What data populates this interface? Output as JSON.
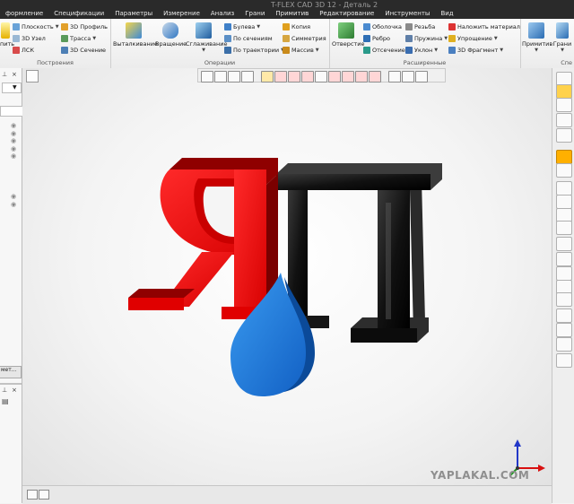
{
  "window_title": "T-FLEX CAD 3D 12 - Деталь 2",
  "menu_tabs": [
    "формление",
    "Спецификации",
    "Параметры",
    "Измерение",
    "Анализ",
    "Грани",
    "Примитив",
    "Редактирование",
    "Инструменты",
    "Вид"
  ],
  "ribbon": {
    "build": {
      "partial_left": "пить",
      "plane": "Плоскость",
      "node3d": "3D Узел",
      "lsk": "ЛСК",
      "profile3d": "3D Профиль",
      "path": "Трасса",
      "section3d": "3D Сечение",
      "label": "Построения"
    },
    "ops": {
      "extrude": "Выталкивание",
      "rotate": "Вращение",
      "smooth": "Сглаживание",
      "boolean": "Булева",
      "by_sections": "По сечениям",
      "by_path": "По траектории",
      "copy": "Копия",
      "symmetry": "Симметрия",
      "array": "Массив",
      "label": "Операции"
    },
    "ext": {
      "hole": "Отверстие",
      "shell": "Оболочка",
      "edge": "Ребро",
      "cut": "Отсечение",
      "thread": "Резьба",
      "spring": "Пружина",
      "slope": "Уклон",
      "material": "Наложить материал",
      "simplify": "Упрощение",
      "fragment3d": "3D Фрагмент",
      "label": "Расширенные"
    },
    "right": {
      "primitives": "Примитив",
      "faces": "Грани",
      "partial_label": "Спе"
    }
  },
  "left_panel": {
    "tab_partial": "мет..."
  },
  "watermark": "YAPLAKAL.COM",
  "model_letters": [
    "Я",
    "П"
  ],
  "colors": {
    "letter1": "#e00b0b",
    "letter1_side": "#8f0000",
    "letter2": "#101010",
    "letter2_side": "#3b3b3b",
    "drop": "#1a78d6",
    "drop_side": "#0b4a99",
    "accent": "#f2a800"
  },
  "icons": {
    "menu_app": "app-menu-icon",
    "viewport_corner": "scene-settings-icon",
    "axes": "coordinate-axes-icon"
  }
}
